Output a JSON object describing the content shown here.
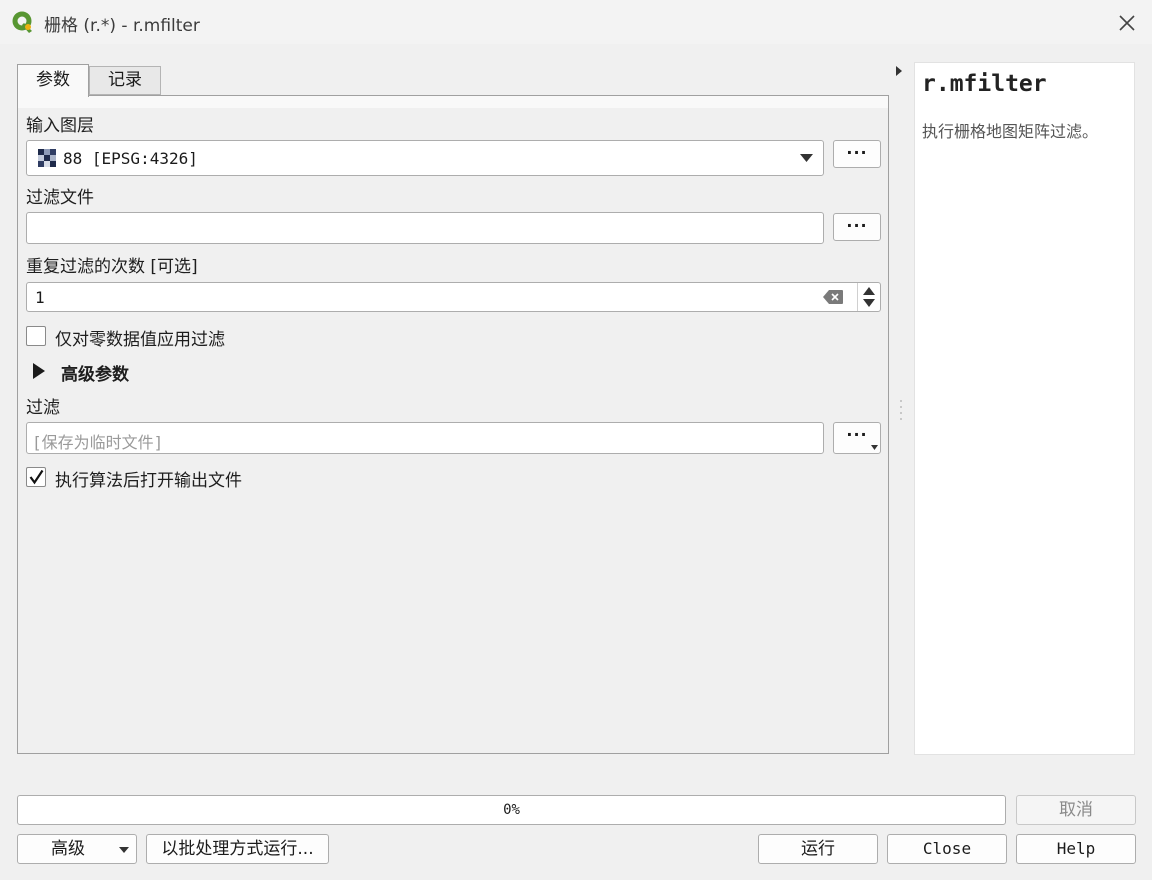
{
  "window": {
    "title": "栅格 (r.*) - r.mfilter"
  },
  "tabs": [
    {
      "label": "参数",
      "active": true
    },
    {
      "label": "记录",
      "active": false
    }
  ],
  "params": {
    "input_layer": {
      "label": "输入图层",
      "value": "88 [EPSG:4326]",
      "browse_label": "···"
    },
    "filter_file": {
      "label": "过滤文件",
      "value": "",
      "browse_label": "···"
    },
    "repeat_count": {
      "label": "重复过滤的次数 [可选]",
      "value": "1"
    },
    "null_only": {
      "label": "仅对零数据值应用过滤",
      "checked": false
    },
    "advanced": {
      "label": "高级参数",
      "expanded": false
    },
    "output": {
      "label": "过滤",
      "placeholder": "[保存为临时文件]",
      "browse_label": "···"
    },
    "open_output": {
      "label": "执行算法后打开输出文件",
      "checked": true
    }
  },
  "help": {
    "title": "r.mfilter",
    "description": "执行栅格地图矩阵过滤。"
  },
  "progress": {
    "value": 0,
    "text": "0%"
  },
  "footer": {
    "advanced_label": "高级",
    "batch_label": "以批处理方式运行...",
    "cancel_label": "取消",
    "run_label": "运行",
    "close_label": "Close",
    "help_label": "Help"
  },
  "colors": {
    "qgis_green": "#589632",
    "qgis_yellow": "#eeb111"
  }
}
